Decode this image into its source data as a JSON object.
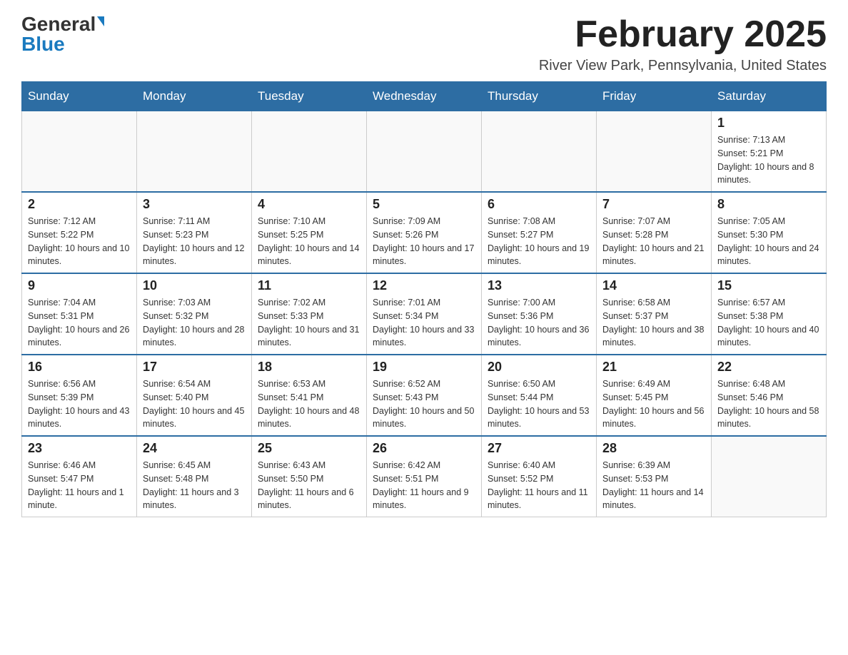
{
  "header": {
    "logo_general": "General",
    "logo_blue": "Blue",
    "title": "February 2025",
    "subtitle": "River View Park, Pennsylvania, United States"
  },
  "days_of_week": [
    "Sunday",
    "Monday",
    "Tuesday",
    "Wednesday",
    "Thursday",
    "Friday",
    "Saturday"
  ],
  "weeks": [
    {
      "days": [
        {
          "num": "",
          "info": ""
        },
        {
          "num": "",
          "info": ""
        },
        {
          "num": "",
          "info": ""
        },
        {
          "num": "",
          "info": ""
        },
        {
          "num": "",
          "info": ""
        },
        {
          "num": "",
          "info": ""
        },
        {
          "num": "1",
          "info": "Sunrise: 7:13 AM\nSunset: 5:21 PM\nDaylight: 10 hours and 8 minutes."
        }
      ]
    },
    {
      "days": [
        {
          "num": "2",
          "info": "Sunrise: 7:12 AM\nSunset: 5:22 PM\nDaylight: 10 hours and 10 minutes."
        },
        {
          "num": "3",
          "info": "Sunrise: 7:11 AM\nSunset: 5:23 PM\nDaylight: 10 hours and 12 minutes."
        },
        {
          "num": "4",
          "info": "Sunrise: 7:10 AM\nSunset: 5:25 PM\nDaylight: 10 hours and 14 minutes."
        },
        {
          "num": "5",
          "info": "Sunrise: 7:09 AM\nSunset: 5:26 PM\nDaylight: 10 hours and 17 minutes."
        },
        {
          "num": "6",
          "info": "Sunrise: 7:08 AM\nSunset: 5:27 PM\nDaylight: 10 hours and 19 minutes."
        },
        {
          "num": "7",
          "info": "Sunrise: 7:07 AM\nSunset: 5:28 PM\nDaylight: 10 hours and 21 minutes."
        },
        {
          "num": "8",
          "info": "Sunrise: 7:05 AM\nSunset: 5:30 PM\nDaylight: 10 hours and 24 minutes."
        }
      ]
    },
    {
      "days": [
        {
          "num": "9",
          "info": "Sunrise: 7:04 AM\nSunset: 5:31 PM\nDaylight: 10 hours and 26 minutes."
        },
        {
          "num": "10",
          "info": "Sunrise: 7:03 AM\nSunset: 5:32 PM\nDaylight: 10 hours and 28 minutes."
        },
        {
          "num": "11",
          "info": "Sunrise: 7:02 AM\nSunset: 5:33 PM\nDaylight: 10 hours and 31 minutes."
        },
        {
          "num": "12",
          "info": "Sunrise: 7:01 AM\nSunset: 5:34 PM\nDaylight: 10 hours and 33 minutes."
        },
        {
          "num": "13",
          "info": "Sunrise: 7:00 AM\nSunset: 5:36 PM\nDaylight: 10 hours and 36 minutes."
        },
        {
          "num": "14",
          "info": "Sunrise: 6:58 AM\nSunset: 5:37 PM\nDaylight: 10 hours and 38 minutes."
        },
        {
          "num": "15",
          "info": "Sunrise: 6:57 AM\nSunset: 5:38 PM\nDaylight: 10 hours and 40 minutes."
        }
      ]
    },
    {
      "days": [
        {
          "num": "16",
          "info": "Sunrise: 6:56 AM\nSunset: 5:39 PM\nDaylight: 10 hours and 43 minutes."
        },
        {
          "num": "17",
          "info": "Sunrise: 6:54 AM\nSunset: 5:40 PM\nDaylight: 10 hours and 45 minutes."
        },
        {
          "num": "18",
          "info": "Sunrise: 6:53 AM\nSunset: 5:41 PM\nDaylight: 10 hours and 48 minutes."
        },
        {
          "num": "19",
          "info": "Sunrise: 6:52 AM\nSunset: 5:43 PM\nDaylight: 10 hours and 50 minutes."
        },
        {
          "num": "20",
          "info": "Sunrise: 6:50 AM\nSunset: 5:44 PM\nDaylight: 10 hours and 53 minutes."
        },
        {
          "num": "21",
          "info": "Sunrise: 6:49 AM\nSunset: 5:45 PM\nDaylight: 10 hours and 56 minutes."
        },
        {
          "num": "22",
          "info": "Sunrise: 6:48 AM\nSunset: 5:46 PM\nDaylight: 10 hours and 58 minutes."
        }
      ]
    },
    {
      "days": [
        {
          "num": "23",
          "info": "Sunrise: 6:46 AM\nSunset: 5:47 PM\nDaylight: 11 hours and 1 minute."
        },
        {
          "num": "24",
          "info": "Sunrise: 6:45 AM\nSunset: 5:48 PM\nDaylight: 11 hours and 3 minutes."
        },
        {
          "num": "25",
          "info": "Sunrise: 6:43 AM\nSunset: 5:50 PM\nDaylight: 11 hours and 6 minutes."
        },
        {
          "num": "26",
          "info": "Sunrise: 6:42 AM\nSunset: 5:51 PM\nDaylight: 11 hours and 9 minutes."
        },
        {
          "num": "27",
          "info": "Sunrise: 6:40 AM\nSunset: 5:52 PM\nDaylight: 11 hours and 11 minutes."
        },
        {
          "num": "28",
          "info": "Sunrise: 6:39 AM\nSunset: 5:53 PM\nDaylight: 11 hours and 14 minutes."
        },
        {
          "num": "",
          "info": ""
        }
      ]
    }
  ]
}
